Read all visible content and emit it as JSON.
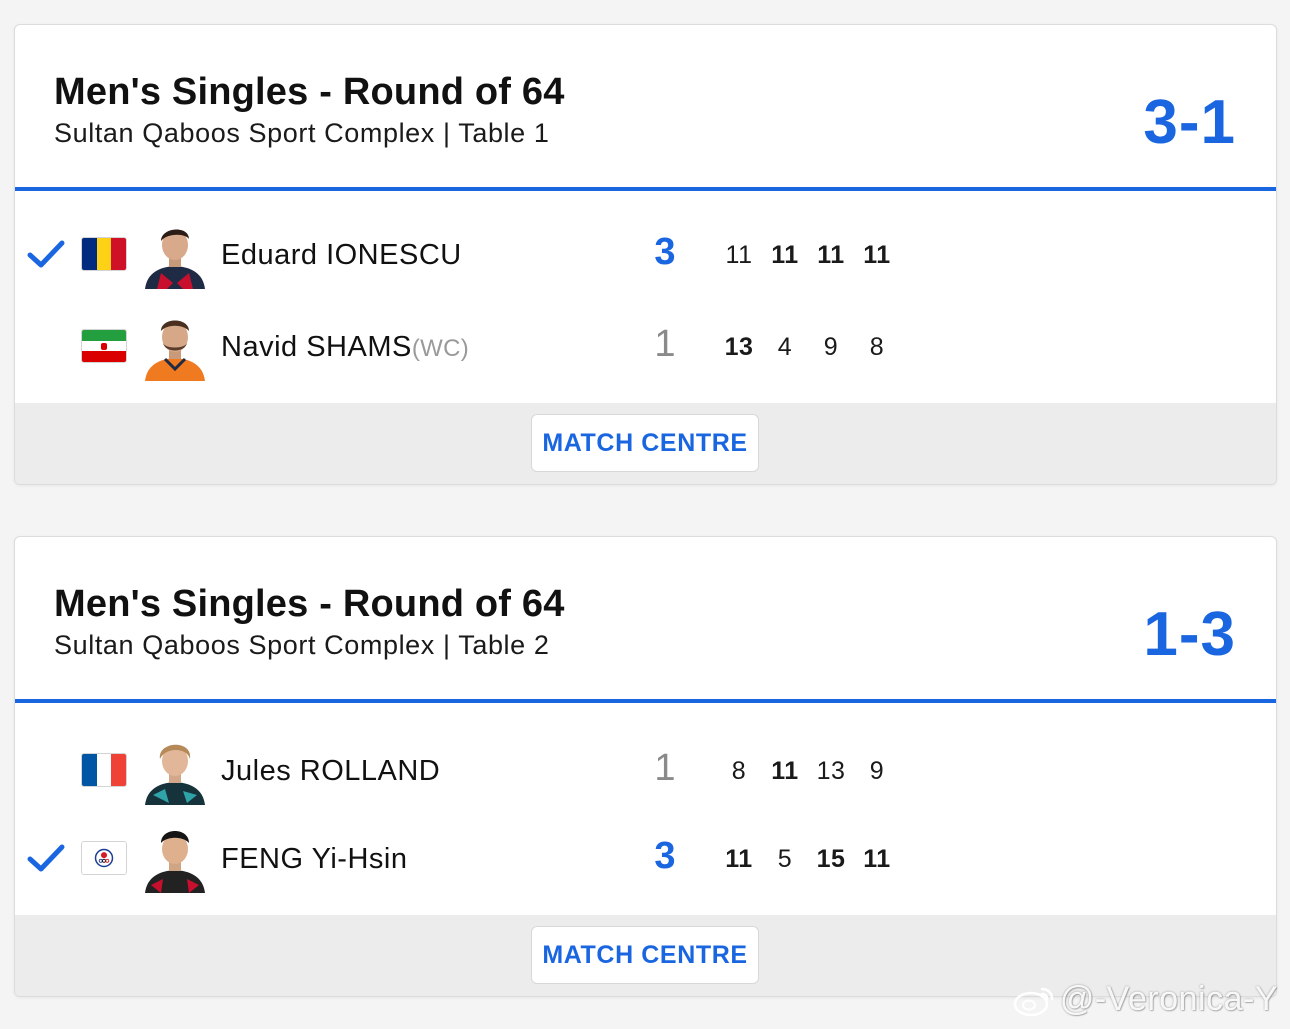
{
  "colors": {
    "accent": "#1a66e0",
    "text": "#111111",
    "muted": "#8a8a8a",
    "footer_bg": "#ececec"
  },
  "matches": [
    {
      "title": "Men's Singles - Round of 64",
      "venue": "Sultan Qaboos Sport Complex | Table 1",
      "score": "3-1",
      "button_label": "MATCH CENTRE",
      "players": [
        {
          "winner": true,
          "flag_icon": "flag-romania-icon",
          "name": "Eduard IONESCU",
          "tag": "",
          "sets": "3",
          "games": [
            "11",
            "11",
            "11",
            "11"
          ],
          "games_won": [
            false,
            true,
            true,
            true
          ]
        },
        {
          "winner": false,
          "flag_icon": "flag-iran-icon",
          "name": "Navid SHAMS",
          "tag": "(WC)",
          "sets": "1",
          "games": [
            "13",
            "4",
            "9",
            "8"
          ],
          "games_won": [
            true,
            false,
            false,
            false
          ]
        }
      ]
    },
    {
      "title": "Men's Singles - Round of 64",
      "venue": "Sultan Qaboos Sport Complex | Table 2",
      "score": "1-3",
      "button_label": "MATCH CENTRE",
      "players": [
        {
          "winner": false,
          "flag_icon": "flag-france-icon",
          "name": "Jules ROLLAND",
          "tag": "",
          "sets": "1",
          "games": [
            "8",
            "11",
            "13",
            "9"
          ],
          "games_won": [
            false,
            true,
            false,
            false
          ]
        },
        {
          "winner": true,
          "flag_icon": "flag-chinese-taipei-icon",
          "name": "FENG Yi-Hsin",
          "tag": "",
          "sets": "3",
          "games": [
            "11",
            "5",
            "15",
            "11"
          ],
          "games_won": [
            true,
            false,
            true,
            true
          ]
        }
      ]
    }
  ],
  "watermark": "@-Veronica-Y"
}
